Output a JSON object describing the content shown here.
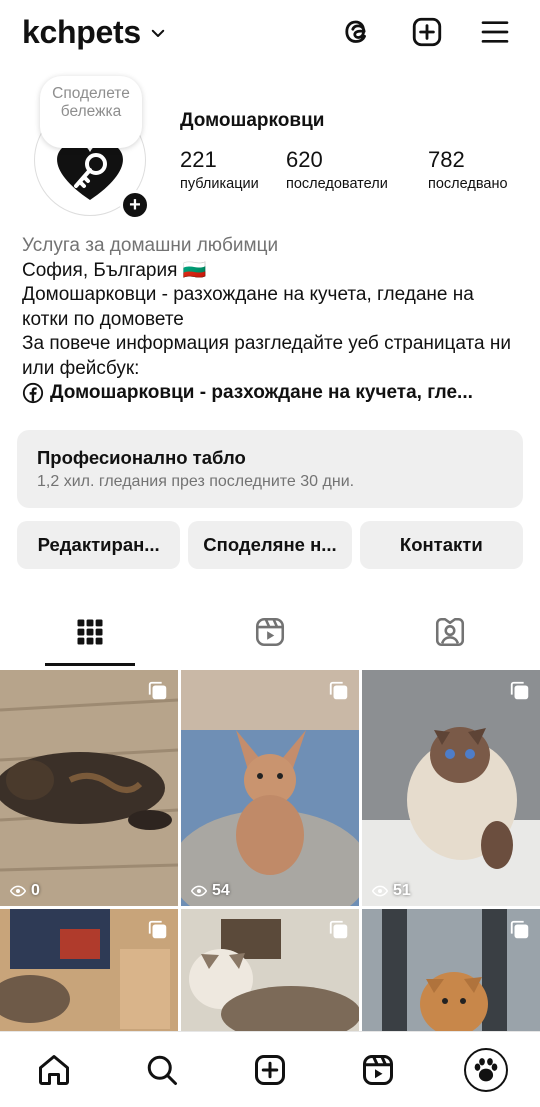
{
  "header": {
    "username": "kchpets",
    "icons": [
      "chevron-down-icon",
      "threads-icon",
      "create-post-icon",
      "menu-icon"
    ]
  },
  "profile": {
    "note": "Споделете бележка",
    "display_name": "Домошарковци",
    "stats": [
      {
        "value": "221",
        "label": "публикации"
      },
      {
        "value": "620",
        "label": "последователи"
      },
      {
        "value": "782",
        "label": "последвано"
      }
    ],
    "bio": {
      "category": "Услуга за домашни любимци",
      "location": "София, България 🇧🇬",
      "line1": "Домошарковци - разхождане на кучета, гледане на котки по домовете",
      "line2": "За повече информация разгледайте уеб страницата ни или фейсбук:",
      "link": "Домошарковци - разхождане на кучета, гле..."
    }
  },
  "dashboard": {
    "title": "Професионално табло",
    "subtitle": "1,2 хил. гледания през последните 30 дни."
  },
  "actions": [
    "Редактиран...",
    "Споделяне н...",
    "Контакти"
  ],
  "tabs": [
    "grid-icon",
    "reels-icon",
    "tagged-icon"
  ],
  "posts": [
    {
      "views": "0"
    },
    {
      "views": "54"
    },
    {
      "views": "51"
    },
    {
      "views": ""
    },
    {
      "views": ""
    },
    {
      "views": ""
    }
  ],
  "colors": {
    "text": "#111111",
    "secondary": "#737373",
    "button_bg": "#efefef"
  }
}
